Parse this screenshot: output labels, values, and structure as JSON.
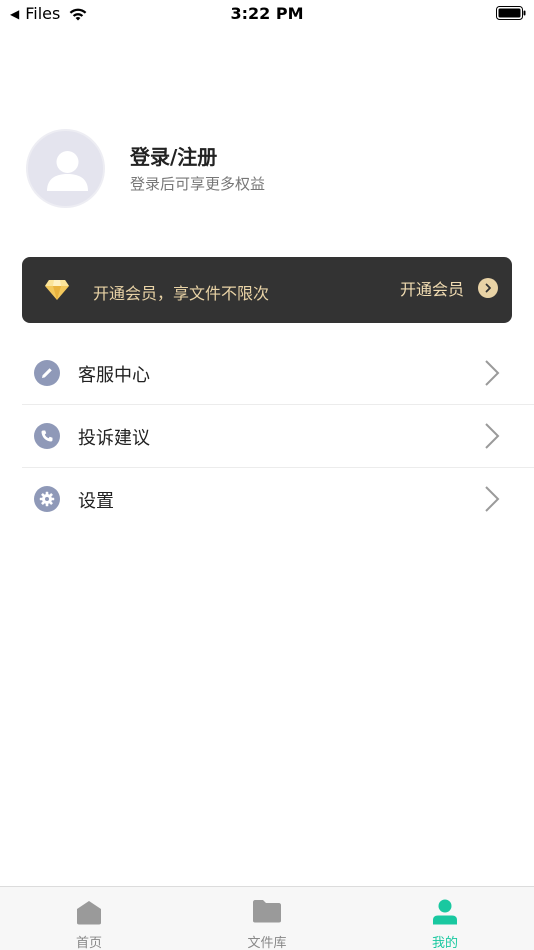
{
  "status_bar": {
    "back_app": "Files",
    "time": "3:22 PM"
  },
  "profile": {
    "title": "登录/注册",
    "subtitle": "登录后可享更多权益",
    "avatar_icon": "user-silhouette-icon"
  },
  "vip_banner": {
    "text": "开通会员，享文件不限次",
    "action_label": "开通会员",
    "icon": "diamond-icon",
    "background": "#333333",
    "text_color": "#e9d3a6"
  },
  "menu": {
    "items": [
      {
        "label": "客服中心",
        "icon": "pencil-icon"
      },
      {
        "label": "投诉建议",
        "icon": "phone-icon"
      },
      {
        "label": "设置",
        "icon": "gear-icon"
      }
    ]
  },
  "tabs": [
    {
      "label": "首页",
      "icon": "home-icon",
      "active": false
    },
    {
      "label": "文件库",
      "icon": "folder-icon",
      "active": false
    },
    {
      "label": "我的",
      "icon": "profile-icon",
      "active": true
    }
  ],
  "colors": {
    "accent": "#19c8a0",
    "menu_icon_bg": "#8f99b8"
  }
}
